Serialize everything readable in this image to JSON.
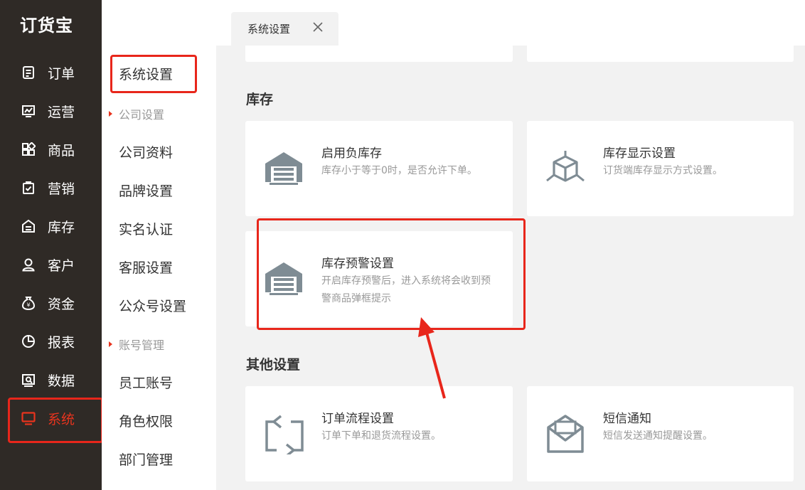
{
  "app": {
    "logo": "订货宝"
  },
  "sidebar": {
    "items": [
      {
        "label": "订单",
        "icon": "order-icon"
      },
      {
        "label": "运营",
        "icon": "operation-icon"
      },
      {
        "label": "商品",
        "icon": "goods-icon"
      },
      {
        "label": "营销",
        "icon": "marketing-icon"
      },
      {
        "label": "库存",
        "icon": "inventory-icon"
      },
      {
        "label": "客户",
        "icon": "customer-icon"
      },
      {
        "label": "资金",
        "icon": "funds-icon"
      },
      {
        "label": "报表",
        "icon": "report-icon"
      },
      {
        "label": "数据",
        "icon": "data-icon"
      },
      {
        "label": "系统",
        "icon": "system-icon",
        "active": true
      }
    ],
    "accent_color": "#e8341e"
  },
  "submenu": {
    "title": "系统设置",
    "groups": [
      {
        "label": "公司设置",
        "items": [
          "公司资料",
          "品牌设置",
          "实名认证",
          "客服设置",
          "公众号设置"
        ]
      },
      {
        "label": "账号管理",
        "items": [
          "员工账号",
          "角色权限",
          "部门管理"
        ]
      }
    ]
  },
  "tabs": [
    {
      "label": "系统设置",
      "close_icon": "close-icon"
    }
  ],
  "main": {
    "sections": [
      {
        "title": "库存",
        "cards": [
          {
            "title": "启用负库存",
            "desc": "库存小于等于0时，是否允许下单。",
            "icon": "warehouse-icon"
          },
          {
            "title": "库存显示设置",
            "desc": "订货端库存显示方式设置。",
            "icon": "cube-icon"
          },
          {
            "title": "库存预警设置",
            "desc": "开启库存预警后，进入系统将会收到预警商品弹框提示",
            "icon": "warehouse-icon"
          }
        ]
      },
      {
        "title": "其他设置",
        "cards": [
          {
            "title": "订单流程设置",
            "desc": "订单下单和退货流程设置。",
            "icon": "flow-icon"
          },
          {
            "title": "短信通知",
            "desc": "短信发送通知提醒设置。",
            "icon": "envelope-icon"
          }
        ]
      }
    ]
  },
  "annotation_color": "#e8261b"
}
